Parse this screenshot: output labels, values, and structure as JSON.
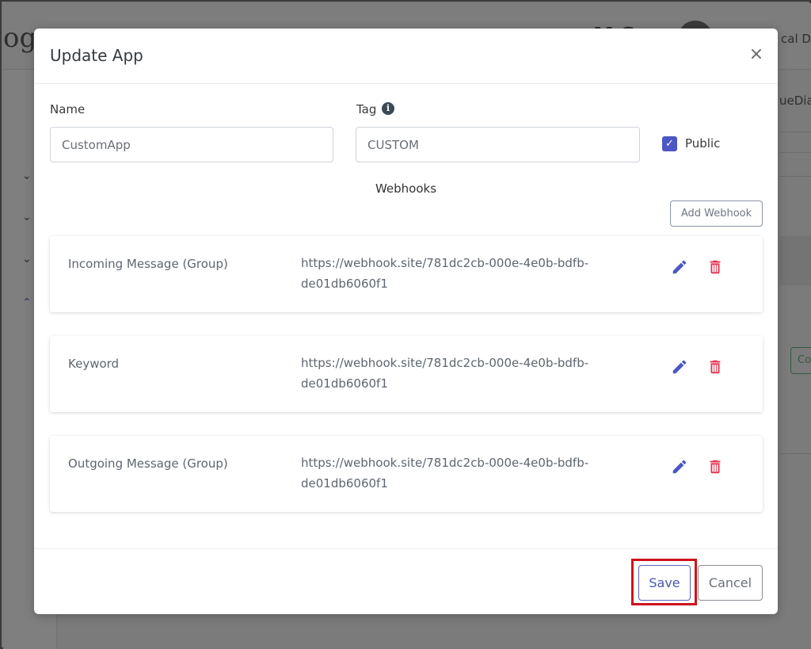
{
  "background": {
    "logo_text": "og",
    "user_name": "M  S",
    "user_role": "cal Do",
    "right_panel_text": "ueDia",
    "right_button_label": "Co",
    "sidebar_chevrons": [
      "⌄",
      "⌄",
      "⌄",
      "⌃"
    ]
  },
  "modal": {
    "title": "Update App",
    "close_glyph": "×",
    "name_label": "Name",
    "name_value": "CustomApp",
    "tag_label": "Tag",
    "tag_value": "CUSTOM",
    "info_glyph": "i",
    "public_label": "Public",
    "public_checked": true,
    "webhooks_title": "Webhooks",
    "add_webhook_label": "Add Webhook",
    "webhooks": [
      {
        "name": "Incoming Message (Group)",
        "url": "https://webhook.site/781dc2cb-000e-4e0b-bdfb-de01db6060f1"
      },
      {
        "name": "Keyword",
        "url": "https://webhook.site/781dc2cb-000e-4e0b-bdfb-de01db6060f1"
      },
      {
        "name": "Outgoing Message (Group)",
        "url": "https://webhook.site/781dc2cb-000e-4e0b-bdfb-de01db6060f1"
      }
    ],
    "save_label": "Save",
    "cancel_label": "Cancel"
  },
  "icons": {
    "close": "close-icon",
    "info": "info-icon",
    "checkbox": "checkmark-icon",
    "edit": "pencil-icon",
    "delete": "trash-icon"
  },
  "colors": {
    "accent": "#4c56c4",
    "edit_icon": "#4c56c4",
    "delete_icon": "#e8344e",
    "highlight": "#d0121b"
  }
}
